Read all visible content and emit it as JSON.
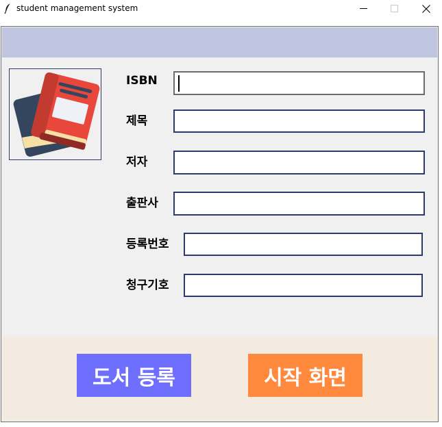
{
  "window": {
    "title": "student management system",
    "controls": [
      "minimize",
      "maximize",
      "close"
    ]
  },
  "colors": {
    "header_band": "#bfc4df",
    "footer_band": "#f4ebe0",
    "register_button": "#6f6fff",
    "home_button": "#ff8a3d",
    "input_border": "#2b3a6b"
  },
  "logo": {
    "icon": "book-stack-icon"
  },
  "form": {
    "fields": [
      {
        "label": "ISBN",
        "value": ""
      },
      {
        "label": "제목",
        "value": ""
      },
      {
        "label": "저자",
        "value": ""
      },
      {
        "label": "출판사",
        "value": ""
      },
      {
        "label": "등록번호",
        "value": ""
      },
      {
        "label": "청구기호",
        "value": ""
      }
    ]
  },
  "actions": {
    "register_label": "도서 등록",
    "home_label": "시작 화면"
  }
}
